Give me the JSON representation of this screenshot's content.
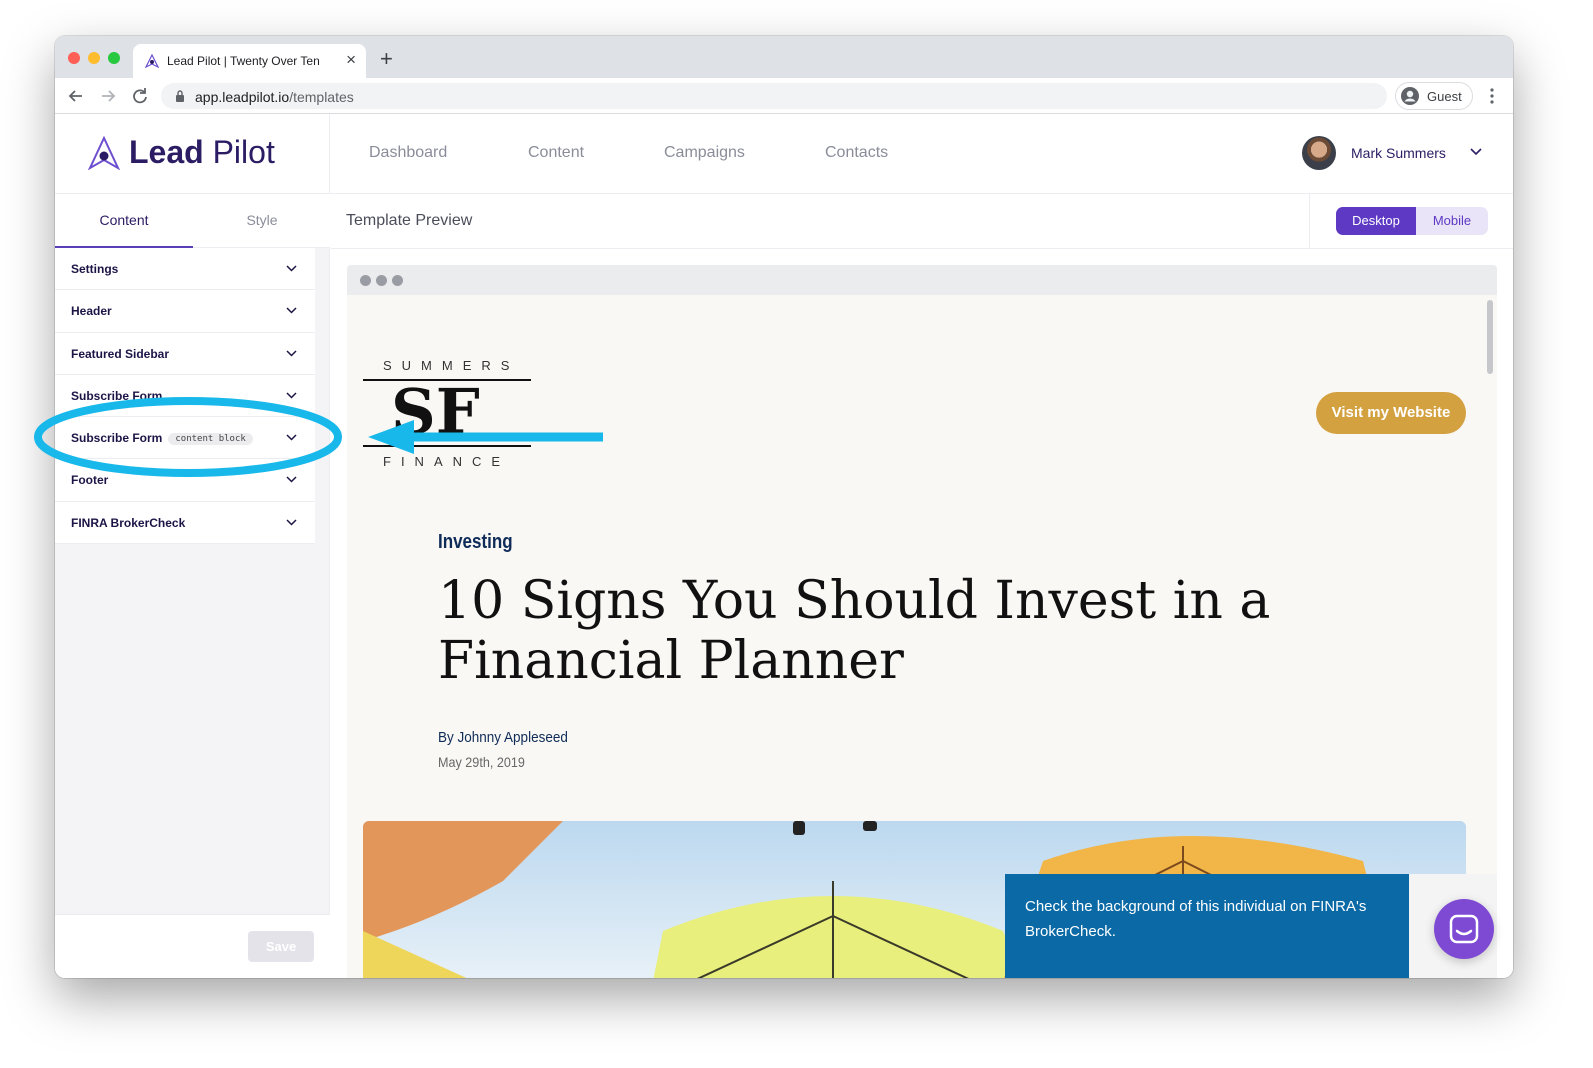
{
  "browser": {
    "tab_title": "Lead Pilot | Twenty Over Ten",
    "tab_close": "×",
    "new_tab": "+",
    "url_host": "app.leadpilot.io",
    "url_path": "/templates",
    "profile_label": "Guest"
  },
  "app": {
    "logo_bold": "Lead",
    "logo_light": " Pilot",
    "nav": [
      "Dashboard",
      "Content",
      "Campaigns",
      "Contacts"
    ],
    "user_name": "Mark Summers"
  },
  "sidebar": {
    "tabs": [
      "Content",
      "Style"
    ],
    "items": [
      {
        "label": "Settings",
        "badge": ""
      },
      {
        "label": "Header",
        "badge": ""
      },
      {
        "label": "Featured Sidebar",
        "badge": ""
      },
      {
        "label": "Subscribe Form",
        "badge": ""
      },
      {
        "label": "Subscribe Form",
        "badge": "content block"
      },
      {
        "label": "Footer",
        "badge": ""
      },
      {
        "label": "FINRA BrokerCheck",
        "badge": ""
      }
    ],
    "save_label": "Save"
  },
  "preview": {
    "title": "Template Preview",
    "device_desktop": "Desktop",
    "device_mobile": "Mobile"
  },
  "site": {
    "logo_top": "SUMMERS",
    "logo_mono": "SF",
    "logo_bottom": "FINANCE",
    "visit_button": "Visit my Website",
    "category": "Investing",
    "article_title": "10 Signs You Should Invest in a Financial Planner",
    "byline": "By Johnny Appleseed",
    "date": "May 29th, 2019",
    "broker_text": "Check the background of this individual on FINRA's BrokerCheck."
  },
  "colors": {
    "brand_purple": "#5d39c4",
    "logo_navy": "#2b1c64",
    "visit_gold": "#d4a140",
    "broker_blue": "#0b6aa6",
    "annotation_cyan": "#18b9ea"
  }
}
